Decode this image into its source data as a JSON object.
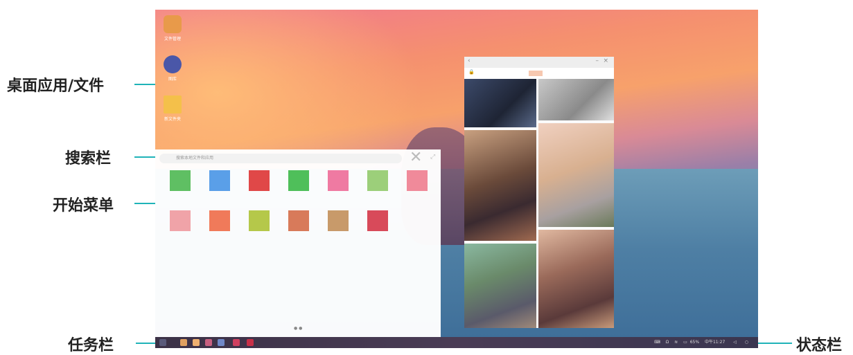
{
  "callouts": {
    "desktop_apps": "桌面应用/文件",
    "search_bar": "搜索栏",
    "start_menu": "开始菜单",
    "taskbar": "任务栏",
    "status_bar": "状态栏"
  },
  "desktop": {
    "icons": [
      {
        "label": "文件管理",
        "color": "#e89a4a"
      },
      {
        "label": "图库",
        "color": "#4a57a8"
      },
      {
        "label": "新文件夹",
        "color": "#f4c04a"
      }
    ]
  },
  "start_menu": {
    "search_placeholder": "搜索本地文件和应用",
    "close_glyph": "✕",
    "expand_glyph": "⤢",
    "pager": "● ●",
    "tiles": [
      {
        "color": "#5fbf63"
      },
      {
        "color": "#5a9fe8"
      },
      {
        "color": "#e04848"
      },
      {
        "color": "#4fbf5a"
      },
      {
        "color": "#ef7aa2"
      },
      {
        "color": "#9ccf7a"
      },
      {
        "color": "#f08a9a"
      },
      {
        "color": "#f0a3a8"
      },
      {
        "color": "#f07a5a"
      },
      {
        "color": "#b5c84a"
      },
      {
        "color": "#d87a5a"
      },
      {
        "color": "#c89a6a"
      },
      {
        "color": "#d84a5a"
      }
    ]
  },
  "phone_window": {
    "back_glyph": "‹",
    "minimize_glyph": "–",
    "close_glyph": "×",
    "lock_glyph": "🔒"
  },
  "taskbar": {
    "apps": [
      {
        "color": "#e0a060"
      },
      {
        "color": "#f0b070"
      },
      {
        "color": "#c86080"
      },
      {
        "color": "#7088c8"
      },
      {
        "color": "#d04060"
      },
      {
        "color": "#c83048"
      }
    ]
  },
  "status_bar": {
    "keyboard_glyph": "⌨",
    "headset_glyph": "Ω",
    "wifi_glyph": "≋",
    "battery_glyph": "▭",
    "battery": "65%",
    "time": "中午11:27",
    "back_glyph": "◁",
    "home_glyph": "○"
  }
}
